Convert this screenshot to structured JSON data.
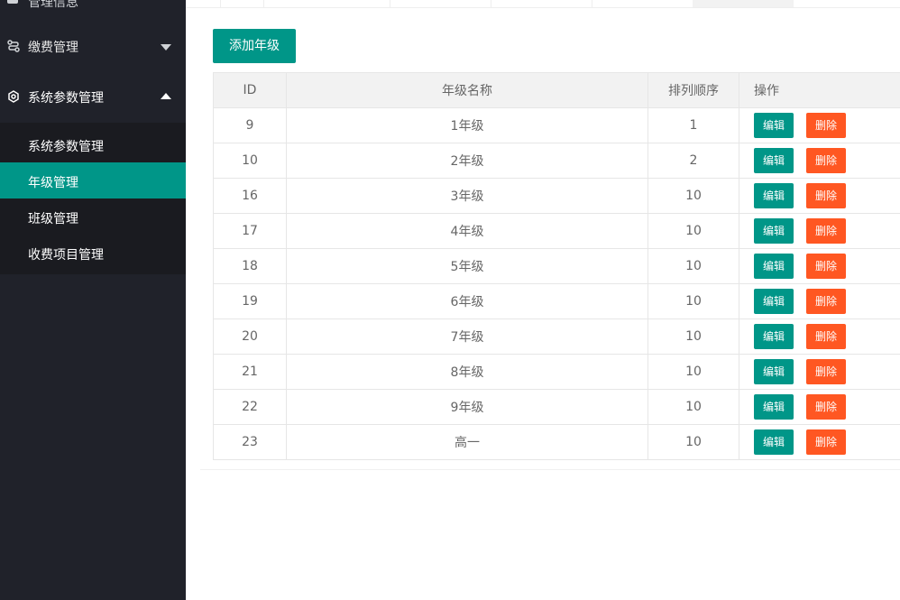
{
  "sidebar": {
    "top_partial": "管理信息",
    "menu": [
      {
        "label": "缴费管理",
        "expanded": false
      },
      {
        "label": "系统参数管理",
        "expanded": true
      }
    ],
    "submenu": [
      {
        "label": "系统参数管理",
        "active": false
      },
      {
        "label": "年级管理",
        "active": true
      },
      {
        "label": "班级管理",
        "active": false
      },
      {
        "label": "收费项目管理",
        "active": false
      }
    ]
  },
  "toolbar": {
    "add_label": "添加年级"
  },
  "table": {
    "headers": [
      "ID",
      "年级名称",
      "排列顺序",
      "操作"
    ],
    "edit_label": "编辑",
    "delete_label": "删除",
    "rows": [
      {
        "id": "9",
        "name": "1年级",
        "order": "1"
      },
      {
        "id": "10",
        "name": "2年级",
        "order": "2"
      },
      {
        "id": "16",
        "name": "3年级",
        "order": "10"
      },
      {
        "id": "17",
        "name": "4年级",
        "order": "10"
      },
      {
        "id": "18",
        "name": "5年级",
        "order": "10"
      },
      {
        "id": "19",
        "name": "6年级",
        "order": "10"
      },
      {
        "id": "20",
        "name": "7年级",
        "order": "10"
      },
      {
        "id": "21",
        "name": "8年级",
        "order": "10"
      },
      {
        "id": "22",
        "name": "9年级",
        "order": "10"
      },
      {
        "id": "23",
        "name": "高一",
        "order": "10"
      }
    ]
  },
  "colors": {
    "primary": "#009688",
    "danger": "#ff5722",
    "sidebar": "#20222a"
  }
}
